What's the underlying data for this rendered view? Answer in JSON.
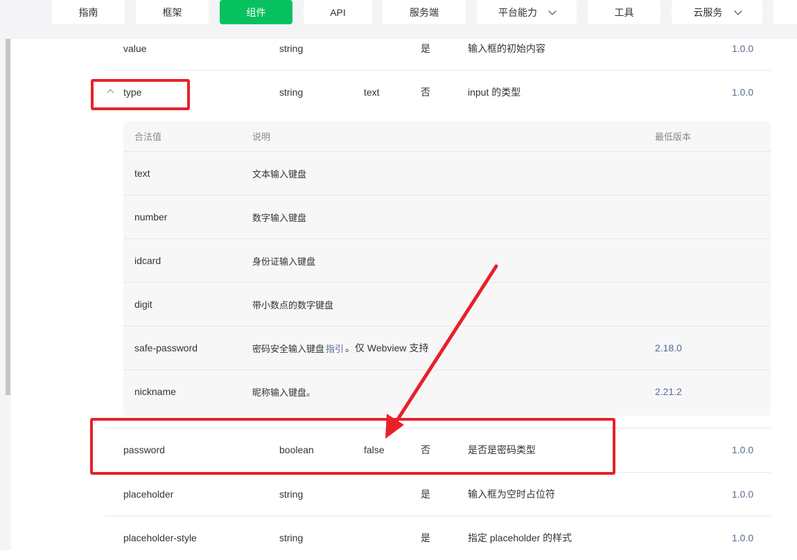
{
  "nav": {
    "items": [
      {
        "label": "指南"
      },
      {
        "label": "框架"
      },
      {
        "label": "组件",
        "active": true
      },
      {
        "label": "API"
      },
      {
        "label": "服务端"
      },
      {
        "label": "平台能力",
        "dropdown": true
      },
      {
        "label": "工具"
      },
      {
        "label": "云服务",
        "dropdown": true
      }
    ]
  },
  "props": {
    "value": {
      "name": "value",
      "type": "string",
      "default": "",
      "required": "是",
      "desc": "输入框的初始内容",
      "version": "1.0.0"
    },
    "type": {
      "name": "type",
      "type": "string",
      "default": "text",
      "required": "否",
      "desc": "input 的类型",
      "version": "1.0.0"
    },
    "password": {
      "name": "password",
      "type": "boolean",
      "default": "false",
      "required": "否",
      "desc": "是否是密码类型",
      "version": "1.0.0"
    },
    "placeholder": {
      "name": "placeholder",
      "type": "string",
      "default": "",
      "required": "是",
      "desc": "输入框为空时占位符",
      "version": "1.0.0"
    },
    "placeholder_style": {
      "name": "placeholder-style",
      "type": "string",
      "default": "",
      "required": "是",
      "desc": "指定 placeholder 的样式",
      "version": "1.0.0"
    }
  },
  "type_values": {
    "headers": {
      "value": "合法值",
      "desc": "说明",
      "version": "最低版本"
    },
    "rows": [
      {
        "value": "text",
        "desc": "文本输入键盘",
        "version": ""
      },
      {
        "value": "number",
        "desc": "数字输入键盘",
        "version": ""
      },
      {
        "value": "idcard",
        "desc": "身份证输入键盘",
        "version": ""
      },
      {
        "value": "digit",
        "desc": "带小数点的数字键盘",
        "version": ""
      },
      {
        "value": "safe-password",
        "desc_pre": "密码安全输入键盘",
        "desc_link": "指引",
        "desc_post": "。仅 Webview 支持",
        "version": "2.18.0"
      },
      {
        "value": "nickname",
        "desc": "昵称输入键盘。",
        "version": "2.21.2"
      }
    ]
  },
  "annotation_color": "#e8202a",
  "accent_color": "#07c160",
  "version_color": "#576b95"
}
